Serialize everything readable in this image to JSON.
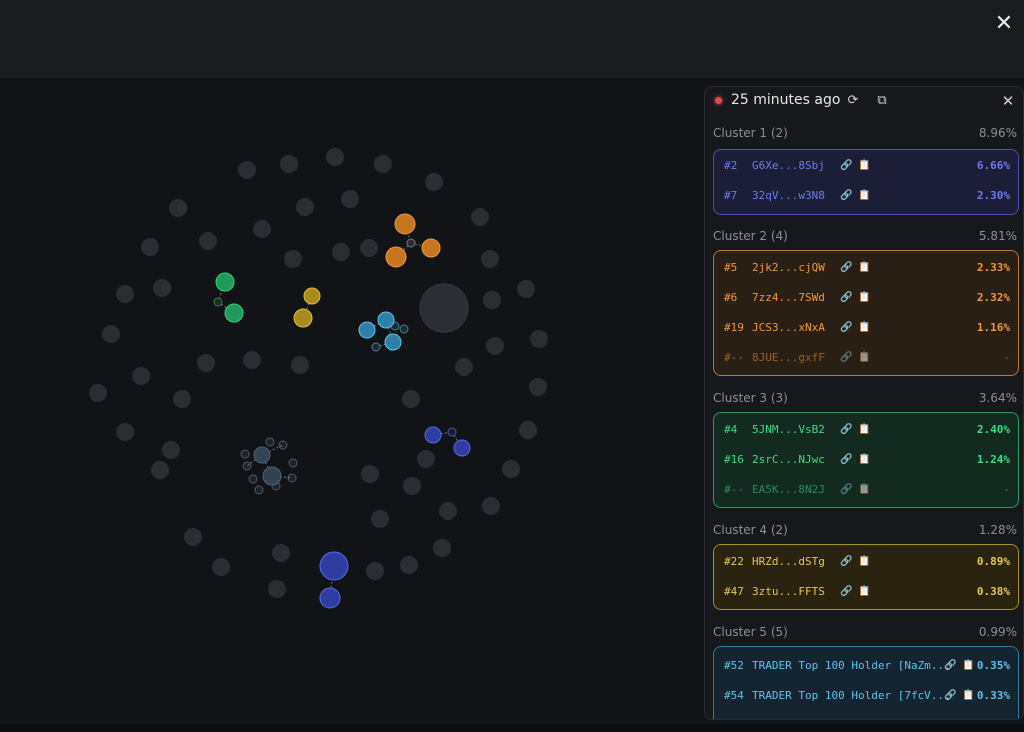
{
  "header": {
    "close_label": "✕"
  },
  "panel": {
    "time_ago": "25 minutes ago",
    "refresh_icon": "⟳",
    "open_icon": "⧉",
    "close_icon": "✕"
  },
  "clusters": [
    {
      "name": "Cluster 1 (2)",
      "percent": "8.96%",
      "color": "#6b7cf2",
      "rows": [
        {
          "rank": "#2",
          "addr": "G6Xe...8Sbj",
          "pct": "6.66%"
        },
        {
          "rank": "#7",
          "addr": "32qV...w3N8",
          "pct": "2.30%"
        }
      ]
    },
    {
      "name": "Cluster 2 (4)",
      "percent": "5.81%",
      "color": "#f0983a",
      "rows": [
        {
          "rank": "#5",
          "addr": "2jk2...cjQW",
          "pct": "2.33%"
        },
        {
          "rank": "#6",
          "addr": "7zz4...7SWd",
          "pct": "2.32%"
        },
        {
          "rank": "#19",
          "addr": "JCS3...xNxA",
          "pct": "1.16%"
        },
        {
          "rank": "#--",
          "addr": "8JUE...gxfF",
          "pct": "-"
        }
      ]
    },
    {
      "name": "Cluster 3 (3)",
      "percent": "3.64%",
      "color": "#3ddc86",
      "rows": [
        {
          "rank": "#4",
          "addr": "5JNM...VsB2",
          "pct": "2.40%"
        },
        {
          "rank": "#16",
          "addr": "2srC...NJwc",
          "pct": "1.24%"
        },
        {
          "rank": "#--",
          "addr": "EA5K...8N2J",
          "pct": "-"
        }
      ]
    },
    {
      "name": "Cluster 4 (2)",
      "percent": "1.28%",
      "color": "#e6c94c",
      "rows": [
        {
          "rank": "#22",
          "addr": "HRZd...dSTg",
          "pct": "0.89%"
        },
        {
          "rank": "#47",
          "addr": "3ztu...FFTS",
          "pct": "0.38%"
        }
      ]
    },
    {
      "name": "Cluster 5 (5)",
      "percent": "0.99%",
      "color": "#5cc3ec",
      "rows": [
        {
          "rank": "#52",
          "addr": "TRADER Top 100 Holder [NaZm...",
          "pct": "0.35%"
        },
        {
          "rank": "#54",
          "addr": "TRADER Top 100 Holder [7fcV...",
          "pct": "0.33%"
        }
      ]
    }
  ],
  "row_icons": {
    "link": "🔗",
    "copy": "📋"
  }
}
